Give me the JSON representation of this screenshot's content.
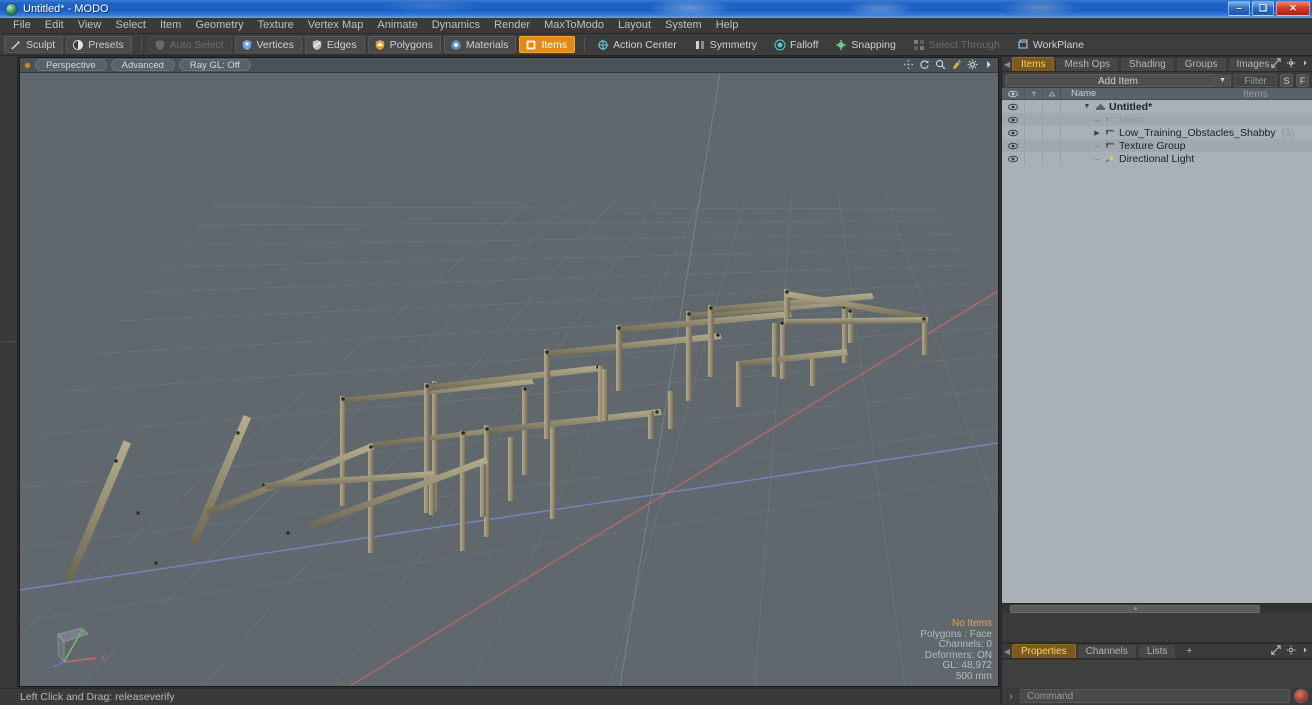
{
  "window": {
    "title": "Untitled* - MODO",
    "minimize_label": "–",
    "maximize_label": "❑",
    "close_label": "✕"
  },
  "menubar": {
    "items": [
      {
        "label": "File"
      },
      {
        "label": "Edit"
      },
      {
        "label": "View"
      },
      {
        "label": "Select"
      },
      {
        "label": "Item"
      },
      {
        "label": "Geometry"
      },
      {
        "label": "Texture"
      },
      {
        "label": "Vertex Map"
      },
      {
        "label": "Animate"
      },
      {
        "label": "Dynamics"
      },
      {
        "label": "Render"
      },
      {
        "label": "MaxToModo"
      },
      {
        "label": "Layout"
      },
      {
        "label": "System"
      },
      {
        "label": "Help"
      }
    ]
  },
  "toolbar": {
    "sculpt": "Sculpt",
    "presets": "Presets",
    "auto_select": "Auto Select",
    "vertices": "Vertices",
    "edges": "Edges",
    "polygons": "Polygons",
    "materials": "Materials",
    "items": "Items",
    "action_center": "Action Center",
    "symmetry": "Symmetry",
    "falloff": "Falloff",
    "snapping": "Snapping",
    "select_through": "Select Through",
    "workplane": "WorkPlane",
    "accent_active": "#e08a18"
  },
  "viewport": {
    "header": {
      "view_mode": "Perspective",
      "shading": "Advanced",
      "raygl": "Ray GL: Off"
    },
    "controls": [
      "pan-icon",
      "rotate-icon",
      "zoom-icon",
      "paint-icon",
      "gear-icon",
      "chevron-right-icon"
    ],
    "stats": {
      "selection": "No Items",
      "polygons": "Polygons : Face",
      "channels": "Channels: 0",
      "deformers": "Deformers: ON",
      "gl": "GL: 48,972",
      "grid": "500 mm"
    },
    "axes": {
      "x": "X",
      "y": "Y",
      "z": "Z"
    },
    "background_color": "#60686d",
    "x_axis_color": "#b86a6a",
    "z_axis_color": "#6a76c0"
  },
  "statusbar": {
    "hint": "Left Click and Drag:  releaseverify"
  },
  "right_panel": {
    "tabs": [
      {
        "label": "Items",
        "active": true
      },
      {
        "label": "Mesh Ops",
        "active": false
      },
      {
        "label": "Shading",
        "active": false
      },
      {
        "label": "Groups",
        "active": false
      },
      {
        "label": "Images",
        "active": false
      },
      {
        "label": "+",
        "active": false
      }
    ],
    "add_item": "Add Item",
    "filter_placeholder": "Filter Items",
    "btn_s": "S",
    "btn_f": "F",
    "tree_header": {
      "eye": "eye-icon",
      "col1": "pin-icon",
      "col2": "render-icon",
      "name": "Name"
    },
    "tree": [
      {
        "label": "Untitled*",
        "count": "",
        "depth": 0,
        "twisty": "open",
        "icon": "scene-icon",
        "bold": true,
        "dim": false
      },
      {
        "label": "Mesh",
        "count": "",
        "depth": 1,
        "twisty": "dash",
        "icon": "mesh-icon",
        "bold": false,
        "dim": true
      },
      {
        "label": "Low_Training_Obstacles_Shabby",
        "count": "(3)",
        "depth": 1,
        "twisty": "closed",
        "icon": "mesh-icon",
        "bold": false,
        "dim": false
      },
      {
        "label": "Texture Group",
        "count": "",
        "depth": 1,
        "twisty": "dash",
        "icon": "group-icon",
        "bold": false,
        "dim": false
      },
      {
        "label": "Directional Light",
        "count": "",
        "depth": 1,
        "twisty": "dash",
        "icon": "light-icon",
        "bold": false,
        "dim": false
      }
    ]
  },
  "bottom_panel": {
    "tabs": [
      {
        "label": "Properties",
        "active": true
      },
      {
        "label": "Channels",
        "active": false
      },
      {
        "label": "Lists",
        "active": false
      },
      {
        "label": "+",
        "active": false
      }
    ],
    "command_placeholder": "Command",
    "command_caret": "›"
  }
}
